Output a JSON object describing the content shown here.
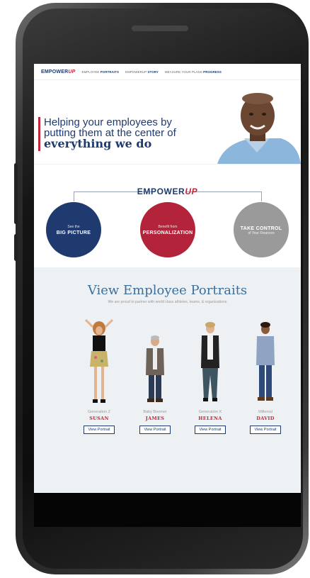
{
  "nav": {
    "logo_main": "EMPOWER",
    "logo_up": "UP",
    "items": [
      {
        "prefix": "EMPLOYEE",
        "strong": "PORTRAITS"
      },
      {
        "prefix": "EMPOWERUP",
        "strong": "STORY"
      },
      {
        "prefix": "MEASURE YOUR PLANS",
        "strong": "PROGRESS"
      }
    ]
  },
  "hero": {
    "line1": "Helping your employees by",
    "line2": "putting them at the center of",
    "line3": "everything we do"
  },
  "empower": {
    "logo_main": "EMPOWER",
    "logo_up": "UP",
    "circles": [
      {
        "small": "See the",
        "big": "BIG PICTURE",
        "color": "#1f3a6e"
      },
      {
        "small": "Benefit from",
        "big": "PERSONALIZATION",
        "color": "#b3243a"
      },
      {
        "small": "of Your Finances",
        "big": "TAKE CONTROL",
        "color": "#9a9a9a"
      }
    ]
  },
  "portraits": {
    "title": "View Employee Portraits",
    "subtitle": "We are proud to partner with world class athletes, teams, & organizations",
    "people": [
      {
        "generation": "Generation Z",
        "name": "SUSAN",
        "button": "View Portrait"
      },
      {
        "generation": "Baby Boomer",
        "name": "JAMES",
        "button": "View Portrait"
      },
      {
        "generation": "Generation X",
        "name": "HELENA",
        "button": "View Portrait"
      },
      {
        "generation": "Millenial",
        "name": "DAVID",
        "button": "View Portrait"
      }
    ]
  },
  "colors": {
    "navy": "#1f3a6e",
    "red": "#c2263a",
    "gray": "#9a9a9a",
    "portrait_bg": "#eef1f3"
  }
}
